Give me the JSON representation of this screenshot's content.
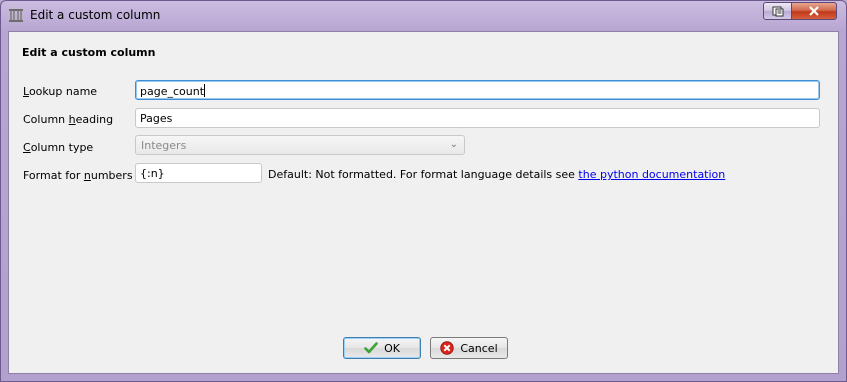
{
  "window": {
    "title": "Edit a custom column",
    "help_icon": "context-help-icon",
    "close_icon": "close-icon"
  },
  "dialog": {
    "heading": "Edit a custom column",
    "fields": {
      "lookup_name": {
        "label_pre": "",
        "label_u": "L",
        "label_post": "ookup name",
        "value": "page_count"
      },
      "column_heading": {
        "label_pre": "Column ",
        "label_u": "h",
        "label_post": "eading",
        "value": "Pages"
      },
      "column_type": {
        "label_pre": "",
        "label_u": "C",
        "label_post": "olumn type",
        "value": "Integers"
      },
      "number_format": {
        "label_pre": "Format for ",
        "label_u": "n",
        "label_post": "umbers",
        "value": "{:n}"
      }
    },
    "format_hint": "Default: Not formatted. For format language details see ",
    "format_link": "the python documentation"
  },
  "buttons": {
    "ok": {
      "label": "OK",
      "icon": "checkmark-icon"
    },
    "cancel": {
      "label": "Cancel",
      "icon": "cancel-icon"
    }
  },
  "colors": {
    "title_bar": "#b8a6d2",
    "close_button": "#c0391c",
    "focus_border": "#3c8fd6",
    "link": "#0000ee"
  }
}
